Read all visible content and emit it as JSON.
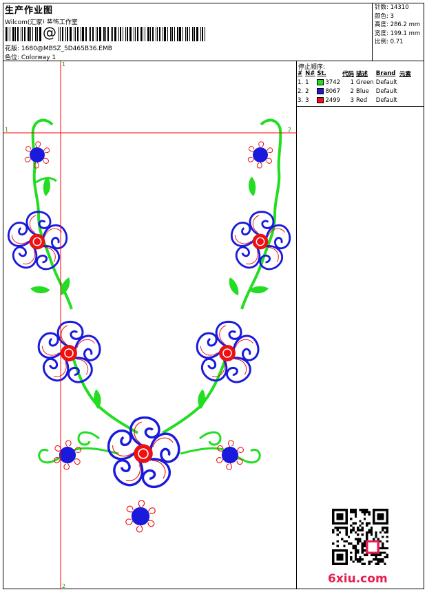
{
  "header": {
    "title": "生产作业图",
    "company": "Wilcom(汇家) 装饰工作室",
    "barcode_symbol": "@",
    "design_label": "花版:",
    "design_value": "1680@MBSZ_5D465B36.EMB",
    "colorway_label": "色位:",
    "colorway_value": "Colorway 1"
  },
  "stats": {
    "stitches_label": "针数:",
    "stitches_value": "14310",
    "colors_label": "颜色:",
    "colors_value": "3",
    "height_label": "高度:",
    "height_value": "286.2 mm",
    "width_label": "宽度:",
    "width_value": "199.1 mm",
    "scale_label": "比例:",
    "scale_value": "0.71"
  },
  "stop_sequence": {
    "title": "停止顺序:",
    "headers": [
      "#",
      "N#",
      "St.",
      "代码",
      "描述",
      "Brand",
      "元素"
    ],
    "rows": [
      {
        "num": "1.",
        "n": "1",
        "stitches": "3742",
        "code": "1",
        "desc": "Green",
        "brand": "Default",
        "color": "#22dd22"
      },
      {
        "num": "2.",
        "n": "2",
        "stitches": "8067",
        "code": "2",
        "desc": "Blue",
        "brand": "Default",
        "color": "#1a1adc"
      },
      {
        "num": "3.",
        "n": "3",
        "stitches": "2499",
        "code": "3",
        "desc": "Red",
        "brand": "Default",
        "color": "#ee1111"
      }
    ]
  },
  "guides": {
    "v_top_label": "1",
    "v_bottom_label": "2",
    "h_left_label": "1",
    "h_right_label": "2"
  },
  "colors": {
    "guide": "#ff0000",
    "guide_label": "#00a000",
    "thread_green": "#22dd22",
    "thread_blue": "#1a1adc",
    "thread_red": "#ee1111"
  },
  "watermark": "6xiu.com"
}
